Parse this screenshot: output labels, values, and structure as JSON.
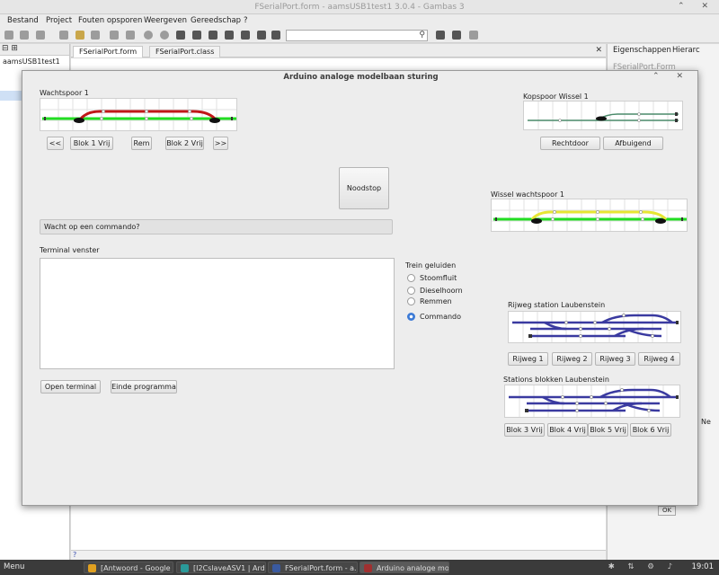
{
  "ide": {
    "title": "FSerialPort.form - aamsUSB1test1 3.0.4 - Gambas 3",
    "window_buttons": "⌃ ✕",
    "menu": [
      "Bestand",
      "Project",
      "Fouten opsporen",
      "Weergeven",
      "Gereedschap",
      "?"
    ],
    "tree_root": "aamsUSB1test1",
    "tabs": [
      "FSerialPort.form",
      "FSerialPort.class"
    ],
    "right_tabs": [
      "Eigenschappen",
      "Hierarc"
    ],
    "right_sub": "FSerialPort.Form",
    "status_char": "?",
    "ok_label": "OK",
    "ne_label": "Ne"
  },
  "dialog": {
    "title": "Arduino analoge modelbaan sturing",
    "window_buttons": "⌃ ✕",
    "wachtspoor": {
      "label": "Wachtspoor 1",
      "buttons": [
        "<<",
        "Blok 1 Vrij",
        "Rem",
        "Blok 2 Vrij",
        ">>"
      ]
    },
    "kopspoor": {
      "label": "Kopspoor Wissel 1",
      "buttons": [
        "Rechtdoor",
        "Afbuigend"
      ]
    },
    "noodstop_label": "Noodstop",
    "wissel_wachtspoor_label": "Wissel wachtspoor 1",
    "status_text": "Wacht op een commando?",
    "terminal_label": "Terminal venster",
    "trein_geluiden": {
      "label": "Trein geluiden",
      "options": [
        "Stoomfluit",
        "Dieselhoorn",
        "Remmen",
        "Commando"
      ],
      "selected": "Commando"
    },
    "rijweg": {
      "label": "Rijweg station Laubenstein",
      "buttons": [
        "Rijweg 1",
        "Rijweg 2",
        "Rijweg 3",
        "Rijweg 4"
      ]
    },
    "stations": {
      "label": "Stations blokken Laubenstein",
      "buttons": [
        "Blok 3 Vrij",
        "Blok 4 Vrij",
        "Blok 5 Vrij",
        "Blok 6 Vrij"
      ]
    },
    "bottom_buttons": [
      "Open terminal",
      "Einde programma"
    ]
  },
  "taskbar": {
    "menu_label": "Menu",
    "items": [
      "[Antwoord - Google ...",
      "[I2CslaveASV1 | Ard...",
      "FSerialPort.form - a...",
      "Arduino analoge mo..."
    ],
    "clock": "19:01"
  },
  "colors": {
    "track_green": "#22dd22",
    "track_red": "#c01818",
    "track_yellow": "#e6e633",
    "track_blue": "#3a3aa0",
    "track_teal": "#4a8a6a"
  }
}
